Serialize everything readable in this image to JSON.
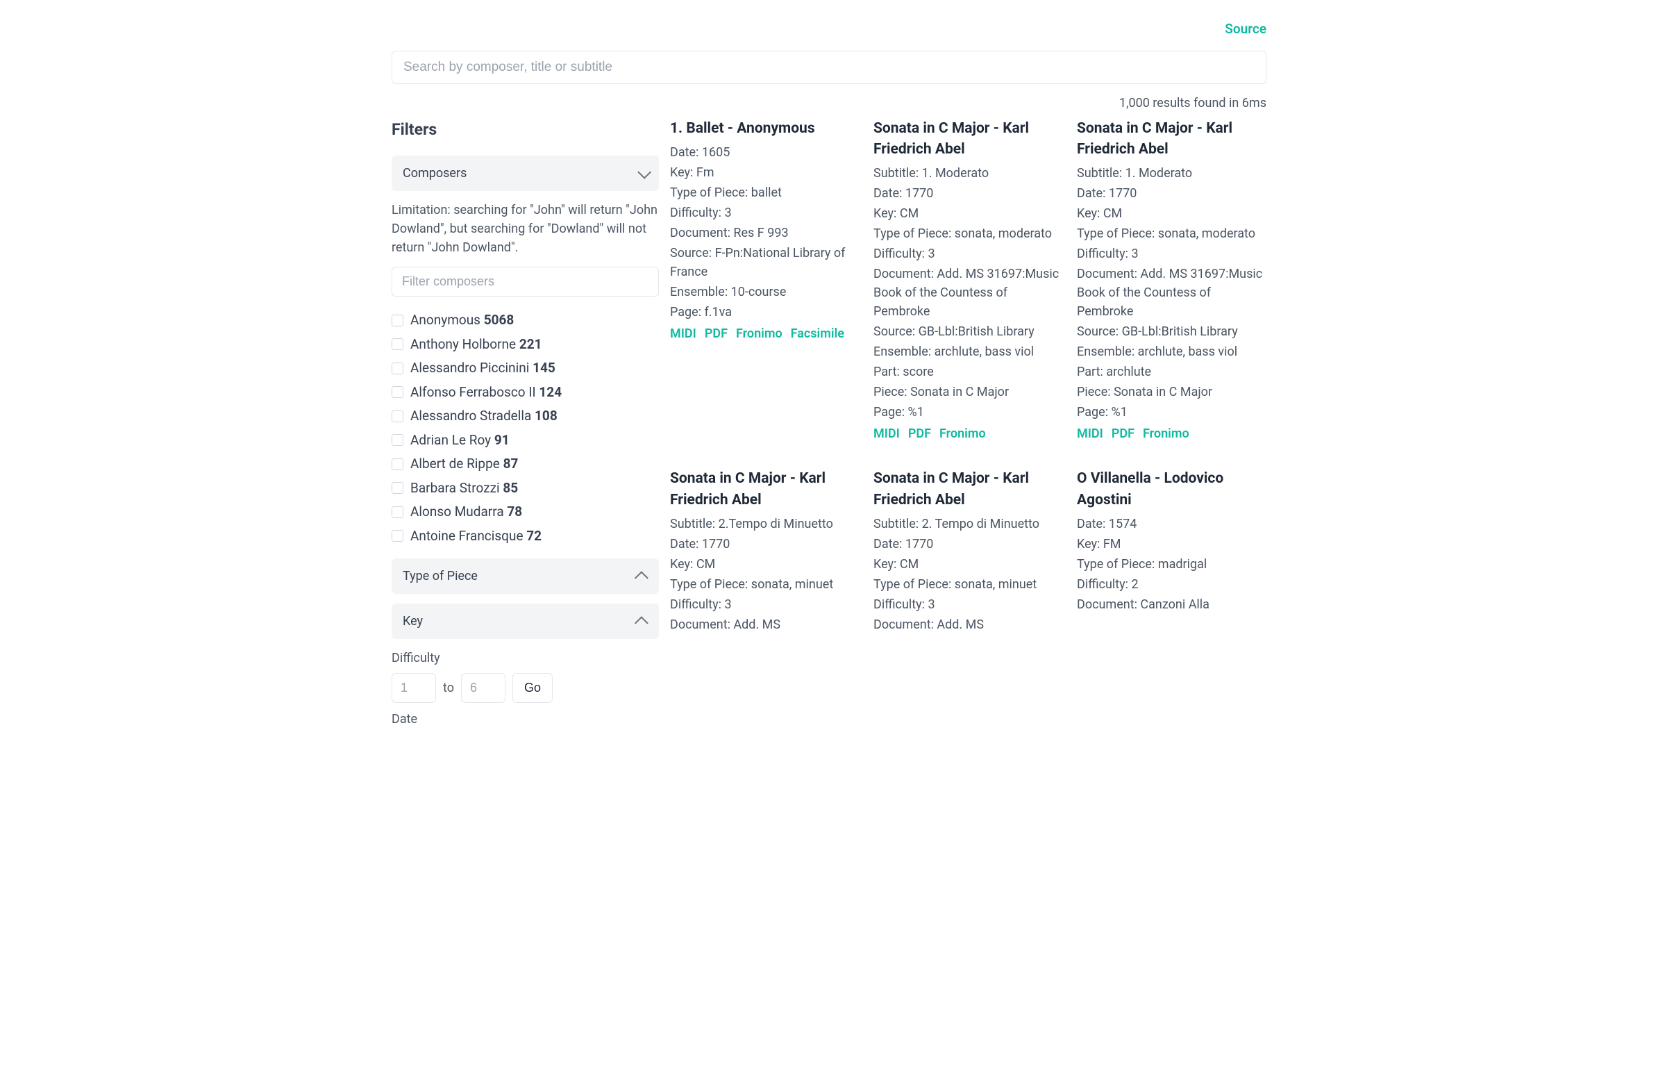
{
  "header": {
    "source_link": "Source"
  },
  "search": {
    "placeholder": "Search by composer, title or subtitle"
  },
  "results_meta": "1,000 results found in 6ms",
  "filters": {
    "title": "Filters",
    "composers": {
      "label": "Composers",
      "limitation": "Limitation: searching for \"John\" will return \"John Dowland\", but searching for \"Dowland\" will not return \"John Dowland\".",
      "filter_placeholder": "Filter composers",
      "items": [
        {
          "name": "Anonymous",
          "count": "5068"
        },
        {
          "name": "Anthony Holborne",
          "count": "221"
        },
        {
          "name": "Alessandro Piccinini",
          "count": "145"
        },
        {
          "name": "Alfonso Ferrabosco II",
          "count": "124"
        },
        {
          "name": "Alessandro Stradella",
          "count": "108"
        },
        {
          "name": "Adrian Le Roy",
          "count": "91"
        },
        {
          "name": "Albert de Rippe",
          "count": "87"
        },
        {
          "name": "Barbara Strozzi",
          "count": "85"
        },
        {
          "name": "Alonso Mudarra",
          "count": "78"
        },
        {
          "name": "Antoine Francisque",
          "count": "72"
        }
      ]
    },
    "type_of_piece_label": "Type of Piece",
    "key_label": "Key",
    "difficulty": {
      "label": "Difficulty",
      "from_placeholder": "1",
      "to_placeholder": "6",
      "to_word": "to",
      "go": "Go"
    },
    "date_label": "Date"
  },
  "labels": {
    "subtitle": "Subtitle: ",
    "date": "Date: ",
    "key": "Key: ",
    "type": "Type of Piece: ",
    "difficulty": "Difficulty: ",
    "document": "Document: ",
    "source": "Source: ",
    "ensemble": "Ensemble: ",
    "page": "Page: ",
    "part": "Part: ",
    "piece": "Piece: "
  },
  "results": [
    {
      "title": "1. Ballet - Anonymous",
      "fields": [
        [
          "date",
          "1605"
        ],
        [
          "key",
          "Fm"
        ],
        [
          "type",
          "ballet"
        ],
        [
          "difficulty",
          "3"
        ],
        [
          "document",
          "Res F 993"
        ],
        [
          "source",
          "F-Pn:National Library of France"
        ],
        [
          "ensemble",
          "10-course"
        ],
        [
          "page",
          "f.1va"
        ]
      ],
      "links": [
        "MIDI",
        "PDF",
        "Fronimo",
        "Facsimile"
      ]
    },
    {
      "title": "Sonata in C Major - Karl Friedrich Abel",
      "fields": [
        [
          "subtitle",
          "1. Moderato"
        ],
        [
          "date",
          "1770"
        ],
        [
          "key",
          "CM"
        ],
        [
          "type",
          "sonata, moderato"
        ],
        [
          "difficulty",
          "3"
        ],
        [
          "document",
          "Add. MS 31697:Music Book of the Countess of Pembroke"
        ],
        [
          "source",
          "GB-Lbl:British Library"
        ],
        [
          "ensemble",
          "archlute, bass viol"
        ],
        [
          "part",
          "score"
        ],
        [
          "piece",
          "Sonata in C Major"
        ],
        [
          "page",
          "%1"
        ]
      ],
      "links": [
        "MIDI",
        "PDF",
        "Fronimo"
      ]
    },
    {
      "title": "Sonata in C Major - Karl Friedrich Abel",
      "fields": [
        [
          "subtitle",
          "1. Moderato"
        ],
        [
          "date",
          "1770"
        ],
        [
          "key",
          "CM"
        ],
        [
          "type",
          "sonata, moderato"
        ],
        [
          "difficulty",
          "3"
        ],
        [
          "document",
          "Add. MS 31697:Music Book of the Countess of Pembroke"
        ],
        [
          "source",
          "GB-Lbl:British Library"
        ],
        [
          "ensemble",
          "archlute, bass viol"
        ],
        [
          "part",
          "archlute"
        ],
        [
          "piece",
          "Sonata in C Major"
        ],
        [
          "page",
          "%1"
        ]
      ],
      "links": [
        "MIDI",
        "PDF",
        "Fronimo"
      ]
    },
    {
      "title": "Sonata in C Major - Karl Friedrich Abel",
      "fields": [
        [
          "subtitle",
          "2.Tempo di Minuetto"
        ],
        [
          "date",
          "1770"
        ],
        [
          "key",
          "CM"
        ],
        [
          "type",
          "sonata, minuet"
        ],
        [
          "difficulty",
          "3"
        ],
        [
          "document",
          "Add. MS"
        ]
      ],
      "links": []
    },
    {
      "title": "Sonata in C Major - Karl Friedrich Abel",
      "fields": [
        [
          "subtitle",
          "2. Tempo di Minuetto"
        ],
        [
          "date",
          "1770"
        ],
        [
          "key",
          "CM"
        ],
        [
          "type",
          "sonata, minuet"
        ],
        [
          "difficulty",
          "3"
        ],
        [
          "document",
          "Add. MS"
        ]
      ],
      "links": []
    },
    {
      "title": "O Villanella - Lodovico Agostini",
      "fields": [
        [
          "date",
          "1574"
        ],
        [
          "key",
          "FM"
        ],
        [
          "type",
          "madrigal"
        ],
        [
          "difficulty",
          "2"
        ],
        [
          "document",
          "Canzoni Alla"
        ]
      ],
      "links": []
    }
  ]
}
